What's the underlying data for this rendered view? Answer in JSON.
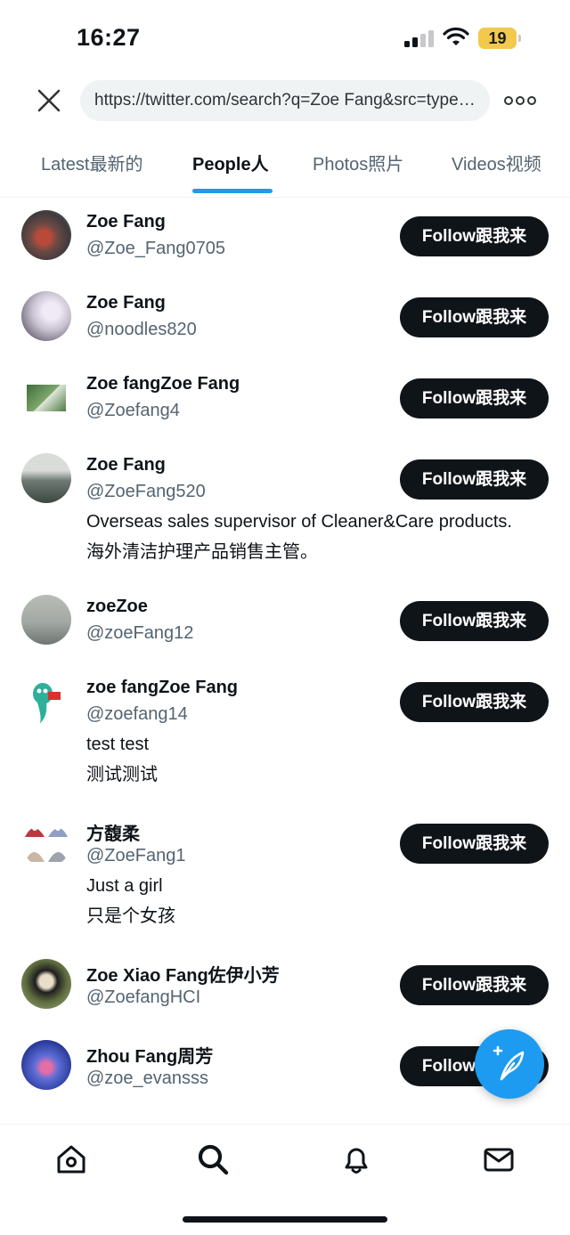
{
  "status_bar": {
    "time": "16:27",
    "battery": "19"
  },
  "browser": {
    "url": "https://twitter.com/search?q=Zoe Fang&src=typed_query&f=user"
  },
  "tabs": [
    {
      "label": "Latest最新的"
    },
    {
      "label": "People人"
    },
    {
      "label": "Photos照片"
    },
    {
      "label": "Videos视频"
    }
  ],
  "follow_label": "Follow跟我来",
  "users": [
    {
      "name": "Zoe Fang",
      "handle": "@Zoe_Fang0705",
      "bio": []
    },
    {
      "name": "Zoe Fang",
      "handle": "@noodles820",
      "bio": []
    },
    {
      "name": "Zoe fangZoe Fang",
      "handle": "@Zoefang4",
      "bio": []
    },
    {
      "name": "Zoe Fang",
      "handle": "@ZoeFang520",
      "bio": [
        "Overseas sales supervisor of Cleaner&Care products.",
        "海外清洁护理产品销售主管。"
      ]
    },
    {
      "name": "zoeZoe",
      "handle": "@zoeFang12",
      "bio": []
    },
    {
      "name": "zoe fangZoe Fang",
      "handle": "@zoefang14",
      "bio": [
        "test test",
        "测试测试"
      ]
    },
    {
      "name": "方馥柔",
      "handle": "@ZoeFang1",
      "bio": [
        "Just a girl",
        "只是个女孩"
      ]
    },
    {
      "name": "Zoe Xiao Fang佐伊小芳",
      "handle": "@ZoefangHCI",
      "bio": []
    },
    {
      "name": "Zhou Fang周芳",
      "handle": "@zoe_evansss",
      "bio": []
    }
  ],
  "accent_color": "#1d9bf0"
}
